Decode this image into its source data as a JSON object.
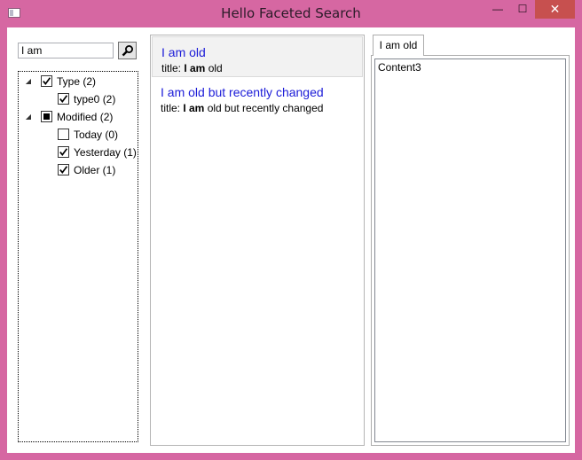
{
  "window": {
    "title": "Hello Faceted Search",
    "minimize": "—",
    "maximize": "☐",
    "close": "✕"
  },
  "search": {
    "query": "I am"
  },
  "facets": {
    "type": {
      "label": "Type (2)",
      "state": "checked",
      "expanded": true,
      "children": [
        {
          "label": "type0 (2)",
          "state": "checked"
        }
      ]
    },
    "modified": {
      "label": "Modified (2)",
      "state": "indeterminate",
      "expanded": true,
      "children": [
        {
          "label": "Today (0)",
          "state": "unchecked"
        },
        {
          "label": "Yesterday (1)",
          "state": "checked"
        },
        {
          "label": "Older (1)",
          "state": "checked"
        }
      ]
    }
  },
  "results": [
    {
      "title": "I am old",
      "prefix": "title: ",
      "match": "I am",
      "suffix": " old",
      "selected": true
    },
    {
      "title": "I am old but recently changed",
      "prefix": "title: ",
      "match": "I am",
      "suffix": " old but recently changed",
      "selected": false
    }
  ],
  "detail": {
    "tab_label": "I am old",
    "content": "Content3"
  },
  "colors": {
    "frame": "#d667a2",
    "link": "#1b1bd8",
    "close_button": "#c7504f"
  }
}
